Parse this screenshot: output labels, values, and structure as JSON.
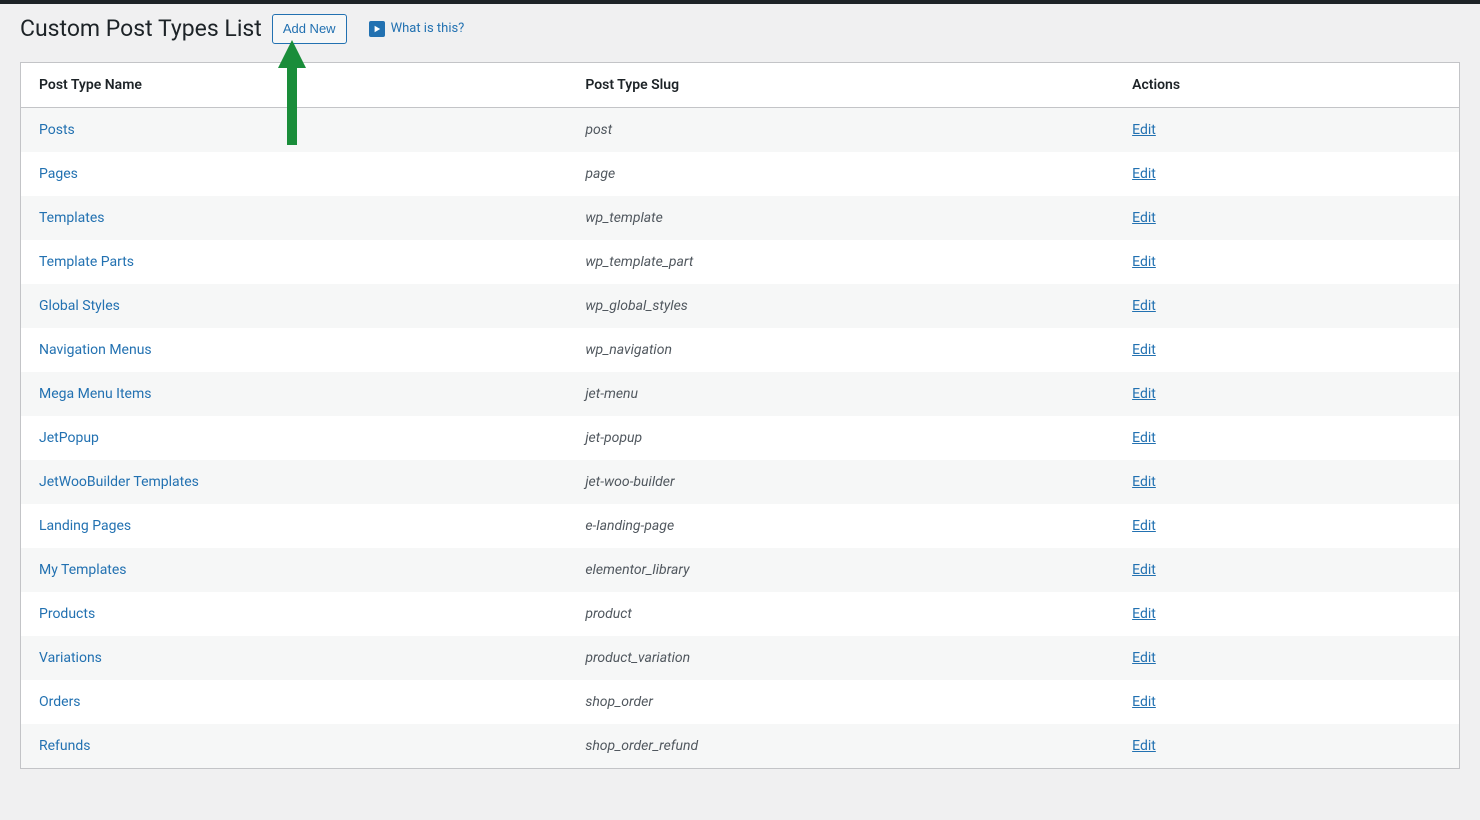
{
  "header": {
    "title": "Custom Post Types List",
    "add_new_label": "Add New",
    "what_is_label": "What is this?"
  },
  "table": {
    "columns": {
      "name": "Post Type Name",
      "slug": "Post Type Slug",
      "actions": "Actions"
    },
    "edit_label": "Edit",
    "rows": [
      {
        "name": "Posts",
        "slug": "post"
      },
      {
        "name": "Pages",
        "slug": "page"
      },
      {
        "name": "Templates",
        "slug": "wp_template"
      },
      {
        "name": "Template Parts",
        "slug": "wp_template_part"
      },
      {
        "name": "Global Styles",
        "slug": "wp_global_styles"
      },
      {
        "name": "Navigation Menus",
        "slug": "wp_navigation"
      },
      {
        "name": "Mega Menu Items",
        "slug": "jet-menu"
      },
      {
        "name": "JetPopup",
        "slug": "jet-popup"
      },
      {
        "name": "JetWooBuilder Templates",
        "slug": "jet-woo-builder"
      },
      {
        "name": "Landing Pages",
        "slug": "e-landing-page"
      },
      {
        "name": "My Templates",
        "slug": "elementor_library"
      },
      {
        "name": "Products",
        "slug": "product"
      },
      {
        "name": "Variations",
        "slug": "product_variation"
      },
      {
        "name": "Orders",
        "slug": "shop_order"
      },
      {
        "name": "Refunds",
        "slug": "shop_order_refund"
      }
    ]
  }
}
